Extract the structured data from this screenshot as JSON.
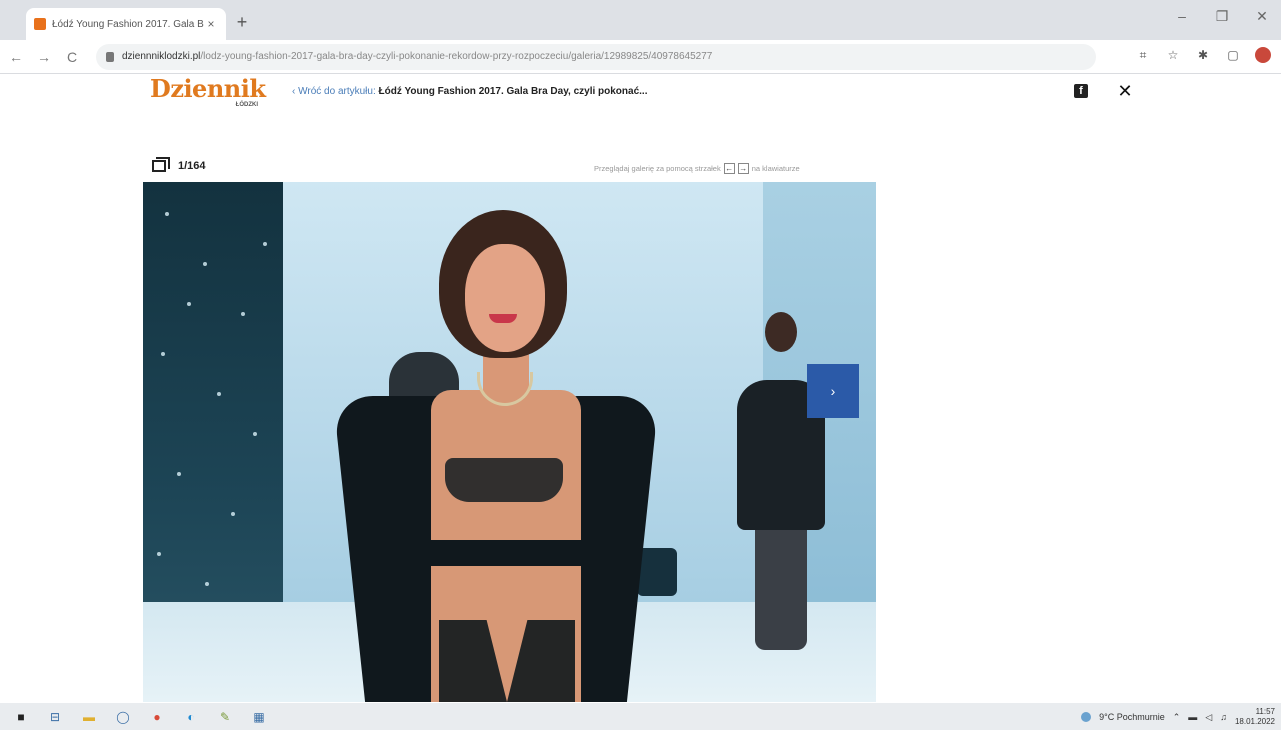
{
  "browser": {
    "tab_title": "Łódź Young Fashion 2017. Gala B",
    "tab_close_glyph": "×",
    "new_tab_glyph": "+",
    "url_domain": "dziennniklodzki.pl",
    "url_path": "/lodz-young-fashion-2017-gala-bra-day-czyli-pokonanie-rekordow-przy-rozpoczeciu/galeria/12989825/40978645277",
    "nav": {
      "back": "←",
      "forward": "→",
      "reload": "C"
    },
    "window_controls": {
      "minimize": "–",
      "restore": "❐",
      "close": "✕"
    }
  },
  "site": {
    "logo_main": "Dziennik",
    "logo_sub": "ŁÓDZKI",
    "back_link": "‹ Wróć do artykułu:",
    "article_title": "Łódź Young Fashion 2017. Gala Bra Day, czyli pokonać...",
    "facebook_glyph": "f",
    "close_glyph": "✕"
  },
  "gallery": {
    "counter": "1/164",
    "hint_prefix": "Przeglądaj galerię za pomocą strzałek",
    "hint_left_key": "←",
    "hint_right_key": "→",
    "hint_suffix": "na klawiaturze",
    "next_glyph": "›"
  },
  "taskbar": {
    "weather": "9°C  Pochmurnie",
    "time": "11:57",
    "date": "18.01.2022"
  },
  "colors": {
    "accent_logo": "#e07a1f",
    "next_button": "#2b5aa8",
    "back_link": "#4a7db8"
  }
}
